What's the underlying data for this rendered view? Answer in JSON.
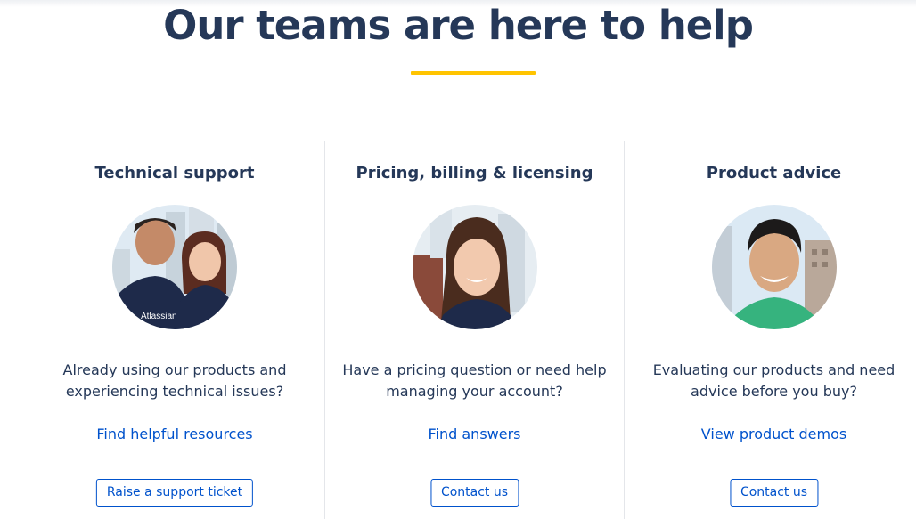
{
  "header": {
    "title": "Our teams are here to help"
  },
  "columns": [
    {
      "title": "Technical support",
      "description": "Already using our products and experiencing technical issues?",
      "link_label": "Find helpful resources",
      "button_label": "Raise a support ticket",
      "photo_alt": "Two smiling support team members"
    },
    {
      "title": "Pricing, billing & licensing",
      "description": "Have a pricing question or need help managing your account?",
      "link_label": "Find answers",
      "button_label": "Contact us",
      "photo_alt": "Smiling billing team member"
    },
    {
      "title": "Product advice",
      "description": "Evaluating our products and need advice before you buy?",
      "link_label": "View product demos",
      "button_label": "Contact us",
      "photo_alt": "Smiling product advisor"
    }
  ],
  "photo_shirt_text": "Atlassian",
  "colors": {
    "heading": "#253858",
    "accent_underline": "#ffc400",
    "link": "#0052cc",
    "divider": "#e4e6ea"
  }
}
